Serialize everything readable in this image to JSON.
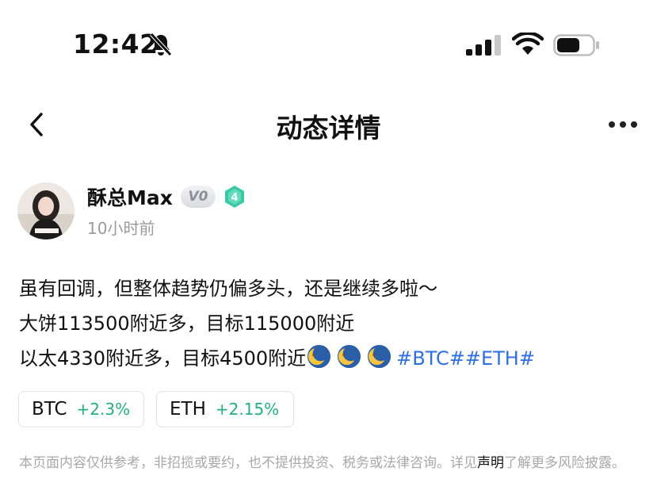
{
  "status_bar": {
    "time": "12:42",
    "icons": [
      "bell-muted-icon",
      "signal-icon",
      "wifi-icon",
      "battery-icon"
    ]
  },
  "nav": {
    "title": "动态详情",
    "back_icon": "chevron-left-icon",
    "more_icon": "more-dots-icon"
  },
  "author": {
    "name": "酥总Max",
    "vip_label": "V0",
    "level": "4",
    "time_ago": "10小时前"
  },
  "post": {
    "line1": "虽有回调，但整体趋势仍偏多头，还是继续多啦～",
    "line2": "大饼113500附近多，目标115000附近",
    "line3": "以太4330附近多，目标4500附近",
    "emoji_icon": "crescent-moon-face-icon",
    "hashtags": [
      "#BTC#",
      "#ETH#"
    ]
  },
  "tickers": [
    {
      "symbol": "BTC",
      "change": "+2.3%"
    },
    {
      "symbol": "ETH",
      "change": "+2.15%"
    }
  ],
  "disclaimer": {
    "text_before": "本页面内容仅供参考，非招揽或要约，也不提供投资、税务或法律咨询。详见",
    "link": "声明",
    "text_after": "了解更多风险披露。"
  },
  "colors": {
    "accent_link": "#2f6fe4",
    "positive": "#22b07d",
    "muted": "#9b9b9b",
    "level_badge": "#3cc8a6"
  }
}
